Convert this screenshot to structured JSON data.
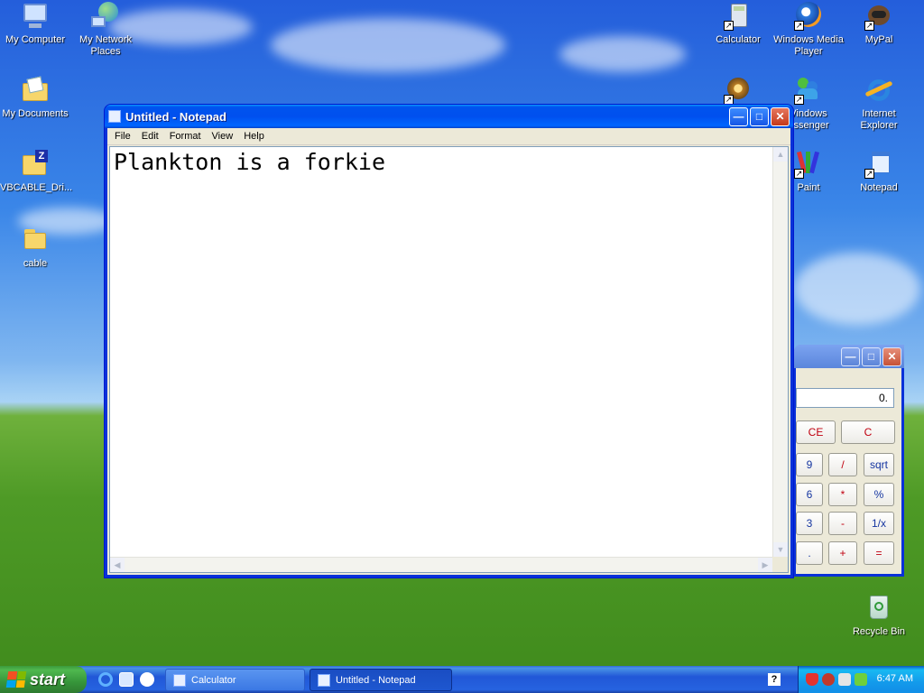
{
  "desktop": {
    "icons_left": [
      {
        "label": "My Computer",
        "icon": "my-computer-icon"
      },
      {
        "label": "My Network Places",
        "icon": "network-places-icon"
      },
      {
        "label": "My Documents",
        "icon": "my-documents-icon"
      },
      {
        "label": "VBCABLE_Dri...",
        "icon": "zip-folder-icon"
      },
      {
        "label": "cable",
        "icon": "folder-icon"
      }
    ],
    "icons_right": [
      {
        "label": "Calculator",
        "icon": "calculator-icon"
      },
      {
        "label": "Windows Media Player",
        "icon": "media-player-icon"
      },
      {
        "label": "MyPal",
        "icon": "mypal-icon"
      },
      {
        "label": "",
        "icon": "movie-maker-icon"
      },
      {
        "label": "Windows Messenger",
        "label_visible": "Vindows\nessenger",
        "icon": "messenger-icon"
      },
      {
        "label": "Internet Explorer",
        "icon": "internet-explorer-icon"
      },
      {
        "label": "Paint",
        "icon": "paint-icon"
      },
      {
        "label": "Notepad",
        "icon": "notepad-icon"
      },
      {
        "label": "Recycle Bin",
        "icon": "recycle-bin-icon"
      }
    ]
  },
  "notepad": {
    "title": "Untitled - Notepad",
    "menu": [
      "File",
      "Edit",
      "Format",
      "View",
      "Help"
    ],
    "content": "Plankton is a forkie"
  },
  "calculator": {
    "display": "0.",
    "buttons": [
      {
        "label": "CE",
        "color": "red"
      },
      {
        "label": "C",
        "color": "red"
      },
      {
        "label": "9",
        "color": "blue"
      },
      {
        "label": "/",
        "color": "red"
      },
      {
        "label": "sqrt",
        "color": "blue"
      },
      {
        "label": "6",
        "color": "blue"
      },
      {
        "label": "*",
        "color": "red"
      },
      {
        "label": "%",
        "color": "blue"
      },
      {
        "label": "3",
        "color": "blue"
      },
      {
        "label": "-",
        "color": "red"
      },
      {
        "label": "1/x",
        "color": "blue"
      },
      {
        "label": ".",
        "color": "blue"
      },
      {
        "label": "+",
        "color": "red"
      },
      {
        "label": "=",
        "color": "red"
      }
    ]
  },
  "taskbar": {
    "start_label": "start",
    "tasks": [
      {
        "label": "Calculator",
        "active": false
      },
      {
        "label": "Untitled - Notepad",
        "active": true
      }
    ],
    "clock": "6:47 AM"
  },
  "colors": {
    "titlebar_blue": "#0053ee",
    "start_green": "#36953a",
    "tray_blue": "#139beb"
  }
}
